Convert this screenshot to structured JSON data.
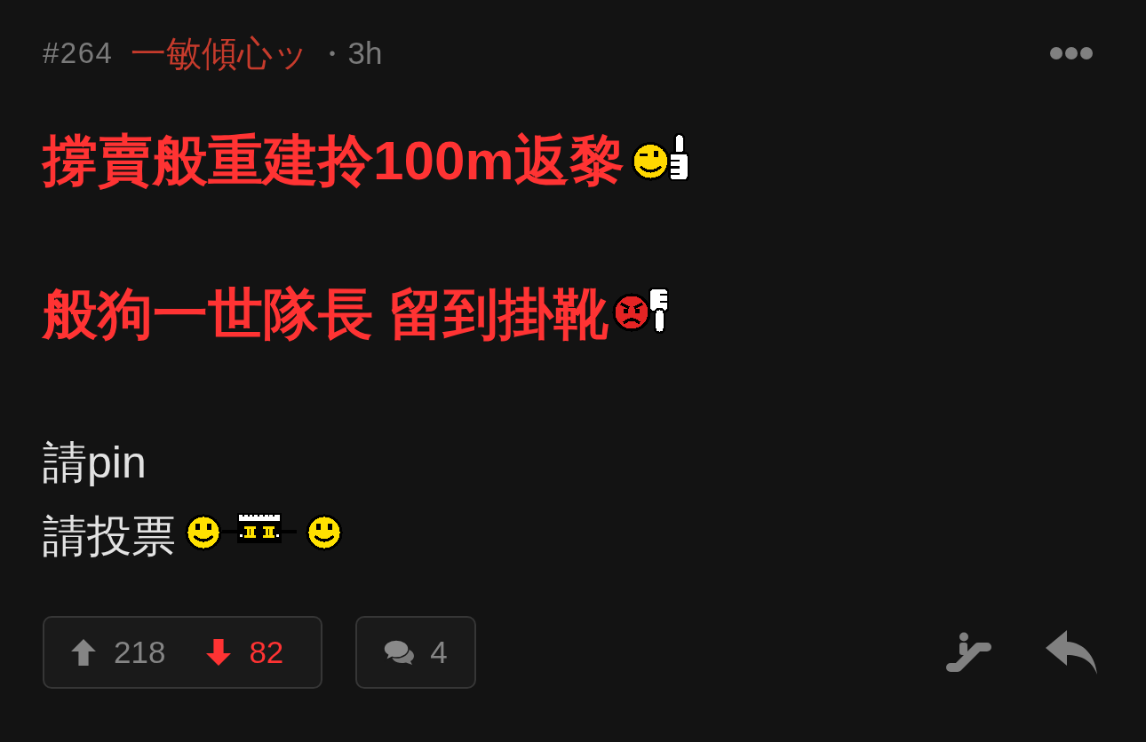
{
  "post": {
    "number": "#264",
    "author": "一敏傾心ッ",
    "separator": "•",
    "time": "3h"
  },
  "paragraphs": [
    {
      "lines": [
        {
          "kind": "emphasis",
          "text": "撐賣般重建拎100m返黎",
          "stickers": [
            {
              "kind": "wink"
            }
          ]
        }
      ]
    },
    {
      "lines": [
        {
          "kind": "emphasis",
          "text": "般狗一世隊長 留到掛靴",
          "stickers": [
            {
              "kind": "angry"
            }
          ]
        }
      ]
    },
    {
      "lines": [
        {
          "kind": "plain",
          "text": "請pin"
        },
        {
          "kind": "plain",
          "text": "請投票",
          "stickers": [
            {
              "kind": "smiley"
            },
            {
              "kind": "barbell"
            },
            {
              "kind": "smiley"
            }
          ]
        }
      ]
    }
  ],
  "votes": [
    {
      "kind": "up",
      "count": "218",
      "selected": false
    },
    {
      "kind": "down",
      "count": "82",
      "selected": true
    }
  ],
  "comments": {
    "count": "4"
  }
}
